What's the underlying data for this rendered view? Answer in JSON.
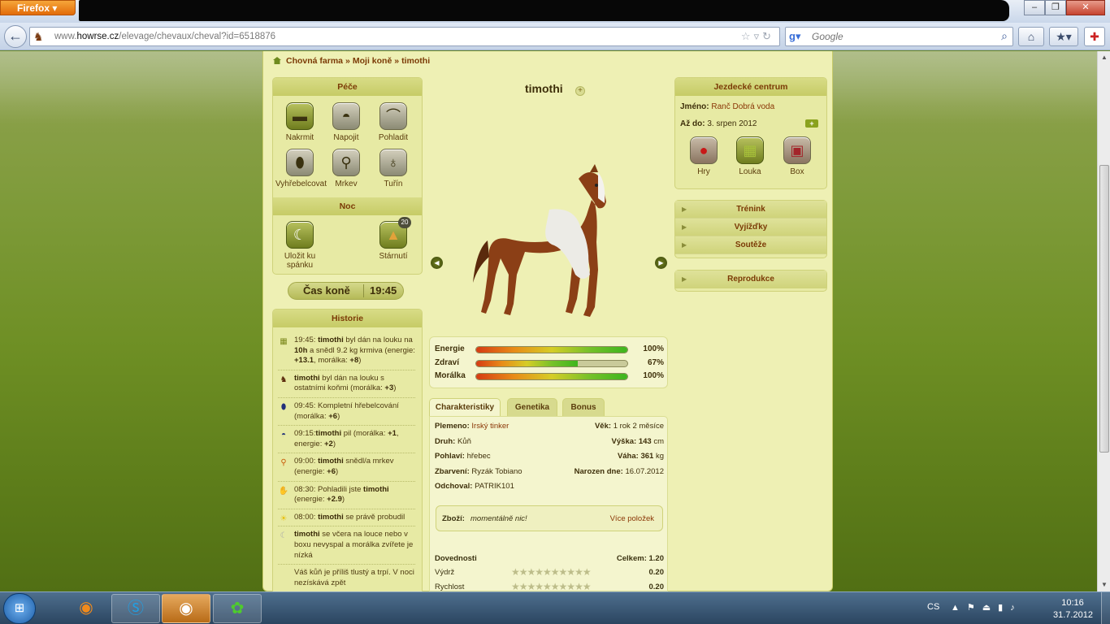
{
  "browser": {
    "menu_button": "Firefox",
    "url_prefix": "www.",
    "url_domain": "howrse.cz",
    "url_path": "/elevage/chevaux/cheval?id=6518876",
    "search_placeholder": "Google"
  },
  "breadcrumb": {
    "item1": "Chovná farma",
    "item2": "Moji koně",
    "item3": "timothi",
    "sep": "»"
  },
  "care": {
    "title": "Péče",
    "actions": [
      "Nakrmit",
      "Napojit",
      "Pohladit",
      "Vyhřebelcovat",
      "Mrkev",
      "Tuřín"
    ]
  },
  "night": {
    "title": "Noc",
    "sleep": "Uložit ku spánku",
    "age": "Stárnutí",
    "age_badge": "20"
  },
  "horse_time": {
    "label": "Čas koně",
    "value": "19:45"
  },
  "history": {
    "title": "Historie",
    "items": [
      {
        "icon": "meadow-icon",
        "parts": [
          "19:45: ",
          "timothi",
          " byl dán na louku na ",
          "10h",
          " a snědl 9.2 kg krmiva (energie: ",
          "+13.1",
          ", morálka: ",
          "+8",
          ")"
        ]
      },
      {
        "icon": "horse-icon",
        "parts": [
          "timothi",
          " byl dán na louku s ostatními koňmi (morálka: ",
          "+3",
          ")"
        ]
      },
      {
        "icon": "brush-icon",
        "parts": [
          "09:45: Kompletní hřebelcování (morálka: ",
          "+6",
          ")"
        ]
      },
      {
        "icon": "water-icon",
        "parts": [
          "09:15:",
          "timothi",
          " pil (morálka: ",
          "+1",
          ", energie: ",
          "+2",
          ")"
        ]
      },
      {
        "icon": "carrot-icon",
        "parts": [
          "09:00: ",
          "timothi",
          " snědl/a mrkev (energie: ",
          "+6",
          ")"
        ]
      },
      {
        "icon": "hand-icon",
        "parts": [
          "08:30: Pohladili jste ",
          "timothi",
          " (energie: ",
          "+2.9",
          ")"
        ]
      },
      {
        "icon": "sun-icon",
        "parts": [
          "08:00: ",
          "timothi",
          " se právě probudil"
        ]
      },
      {
        "icon": "moon-icon",
        "parts": [
          "timothi",
          " se včera na louce nebo v boxu nevyspal a morálka zvířete je nízká"
        ]
      },
      {
        "icon": "",
        "parts": [
          "Váš kůň je příliš tlustý a trpí. V noci nezískává zpět"
        ]
      }
    ]
  },
  "horse": {
    "name": "timothi",
    "add_name": "+"
  },
  "stats": [
    {
      "label": "Energie",
      "value": "100%",
      "fraction": 1.0
    },
    {
      "label": "Zdraví",
      "value": "67%",
      "fraction": 0.67
    },
    {
      "label": "Morálka",
      "value": "100%",
      "fraction": 1.0
    }
  ],
  "tabs": [
    "Charakteristiky",
    "Genetika",
    "Bonus"
  ],
  "characteristics": {
    "breed_label": "Plemeno:",
    "breed": "Irský tinker",
    "age_label": "Věk:",
    "age": "1 rok 2 měsíce",
    "species_label": "Druh:",
    "species": "Kůň",
    "height_label": "Výška:",
    "height": "143",
    "height_unit": "cm",
    "sex_label": "Pohlaví:",
    "sex": "hřebec",
    "weight_label": "Váha:",
    "weight": "361",
    "weight_unit": "kg",
    "coat_label": "Zbarvení:",
    "coat": "Ryzák Tobiano",
    "born_label": "Narozen dne:",
    "born": "16.07.2012",
    "breeder_label": "Odchoval:",
    "breeder": "PATRIK101"
  },
  "goods": {
    "label": "Zboží:",
    "value": "momentálně nic!",
    "link": "Více položek"
  },
  "skills": {
    "title": "Dovednosti",
    "total_label": "Celkem:",
    "total": "1.20",
    "rows": [
      {
        "name": "Výdrž",
        "value": "0.20"
      },
      {
        "name": "Rychlost",
        "value": "0.20"
      }
    ]
  },
  "riding_center": {
    "title": "Jezdecké centrum",
    "name_label": "Jméno:",
    "name": "Ranč Dobrá voda",
    "until_label": "Až do:",
    "until": "3. srpen 2012",
    "actions": [
      "Hry",
      "Louka",
      "Box"
    ]
  },
  "menu": {
    "items": [
      "Trénink",
      "Vyjížďky",
      "Soutěže"
    ],
    "reproduction": "Reprodukce"
  },
  "taskbar": {
    "language": "CS",
    "time": "10:16",
    "date": "31.7.2012"
  }
}
